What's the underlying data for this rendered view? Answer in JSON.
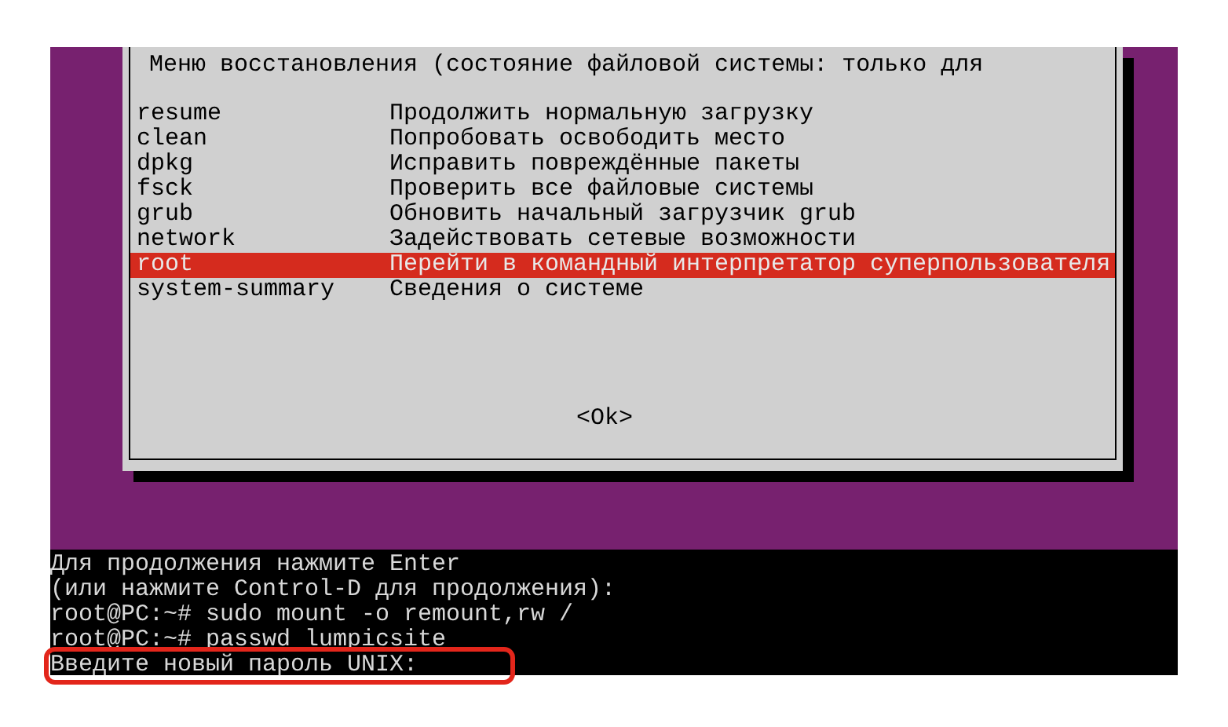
{
  "dialog": {
    "title": "Меню восстановления (состояние файловой системы: только для",
    "items": [
      {
        "name": "resume",
        "description": "Продолжить нормальную загрузку",
        "selected": false
      },
      {
        "name": "clean",
        "description": "Попробовать освободить место",
        "selected": false
      },
      {
        "name": "dpkg",
        "description": "Исправить повреждённые пакеты",
        "selected": false
      },
      {
        "name": "fsck",
        "description": "Проверить все файловые системы",
        "selected": false
      },
      {
        "name": "grub",
        "description": "Обновить начальный загрузчик grub",
        "selected": false
      },
      {
        "name": "network",
        "description": "Задействовать сетевые возможности",
        "selected": false
      },
      {
        "name": "root",
        "description": "Перейти в командный интерпретатор суперпользователя",
        "selected": true
      },
      {
        "name": "system-summary",
        "description": "Сведения о системе",
        "selected": false
      }
    ],
    "button": "<Ok>"
  },
  "terminal": {
    "lines": [
      {
        "text": "Для продолжения нажмите Enter",
        "highlighted": false
      },
      {
        "text": "(или нажмите Control-D для продолжения):",
        "highlighted": false
      },
      {
        "text": "root@PC:~# sudo mount -o remount,rw /",
        "highlighted": false
      },
      {
        "text": "root@PC:~# passwd lumpicsite",
        "highlighted": false
      },
      {
        "text": "Введите новый пароль UNIX:",
        "highlighted": true
      }
    ]
  }
}
